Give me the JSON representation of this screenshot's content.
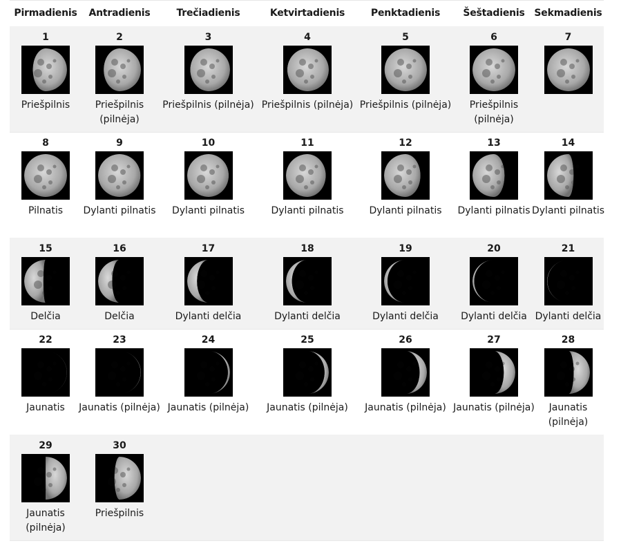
{
  "weekdays": [
    "Pirmadienis",
    "Antradienis",
    "Trečiadienis",
    "Ketvirtadienis",
    "Penktadienis",
    "Šeštadienis",
    "Sekmadienis"
  ],
  "days": [
    {
      "day": "1",
      "phase": "Priešpilnis",
      "illum": 0.8,
      "waxing": true
    },
    {
      "day": "2",
      "phase": "Priešpilnis (pilnėja)",
      "illum": 0.87,
      "waxing": true
    },
    {
      "day": "3",
      "phase": "Priešpilnis (pilnėja)",
      "illum": 0.93,
      "waxing": true
    },
    {
      "day": "4",
      "phase": "Priešpilnis (pilnėja)",
      "illum": 0.97,
      "waxing": true
    },
    {
      "day": "5",
      "phase": "Priešpilnis (pilnėja)",
      "illum": 0.99,
      "waxing": true
    },
    {
      "day": "6",
      "phase": "Priešpilnis (pilnėja)",
      "illum": 1.0,
      "waxing": true
    },
    {
      "day": "7",
      "phase": "",
      "illum": 1.0,
      "waxing": true
    },
    {
      "day": "8",
      "phase": "Pilnatis",
      "illum": 1.0,
      "waxing": false
    },
    {
      "day": "9",
      "phase": "Dylanti pilnatis",
      "illum": 0.99,
      "waxing": false
    },
    {
      "day": "10",
      "phase": "Dylanti pilnatis",
      "illum": 0.97,
      "waxing": false
    },
    {
      "day": "11",
      "phase": "Dylanti pilnatis",
      "illum": 0.93,
      "waxing": false
    },
    {
      "day": "12",
      "phase": "Dylanti pilnatis",
      "illum": 0.85,
      "waxing": false
    },
    {
      "day": "13",
      "phase": "Dylanti pilnatis",
      "illum": 0.75,
      "waxing": false
    },
    {
      "day": "14",
      "phase": "Dylanti pilnatis",
      "illum": 0.62,
      "waxing": false
    },
    {
      "day": "15",
      "phase": "Delčia",
      "illum": 0.45,
      "waxing": false
    },
    {
      "day": "16",
      "phase": "Delčia",
      "illum": 0.33,
      "waxing": false
    },
    {
      "day": "17",
      "phase": "Dylanti delčia",
      "illum": 0.23,
      "waxing": false
    },
    {
      "day": "18",
      "phase": "Dylanti delčia",
      "illum": 0.14,
      "waxing": false
    },
    {
      "day": "19",
      "phase": "Dylanti delčia",
      "illum": 0.08,
      "waxing": false
    },
    {
      "day": "20",
      "phase": "Dylanti delčia",
      "illum": 0.04,
      "waxing": false
    },
    {
      "day": "21",
      "phase": "Dylanti delčia",
      "illum": 0.01,
      "waxing": false
    },
    {
      "day": "22",
      "phase": "Jaunatis",
      "illum": 0.005,
      "waxing": true
    },
    {
      "day": "23",
      "phase": "Jaunatis (pilnėja)",
      "illum": 0.01,
      "waxing": true
    },
    {
      "day": "24",
      "phase": "Jaunatis (pilnėja)",
      "illum": 0.05,
      "waxing": true
    },
    {
      "day": "25",
      "phase": "Jaunatis (pilnėja)",
      "illum": 0.1,
      "waxing": true
    },
    {
      "day": "26",
      "phase": "Jaunatis (pilnėja)",
      "illum": 0.17,
      "waxing": true
    },
    {
      "day": "27",
      "phase": "Jaunatis (pilnėja)",
      "illum": 0.27,
      "waxing": true
    },
    {
      "day": "28",
      "phase": "Jaunatis (pilnėja)",
      "illum": 0.38,
      "waxing": true
    },
    {
      "day": "29",
      "phase": "Jaunatis (pilnėja)",
      "illum": 0.5,
      "waxing": true
    },
    {
      "day": "30",
      "phase": "Priešpilnis",
      "illum": 0.62,
      "waxing": true
    }
  ]
}
